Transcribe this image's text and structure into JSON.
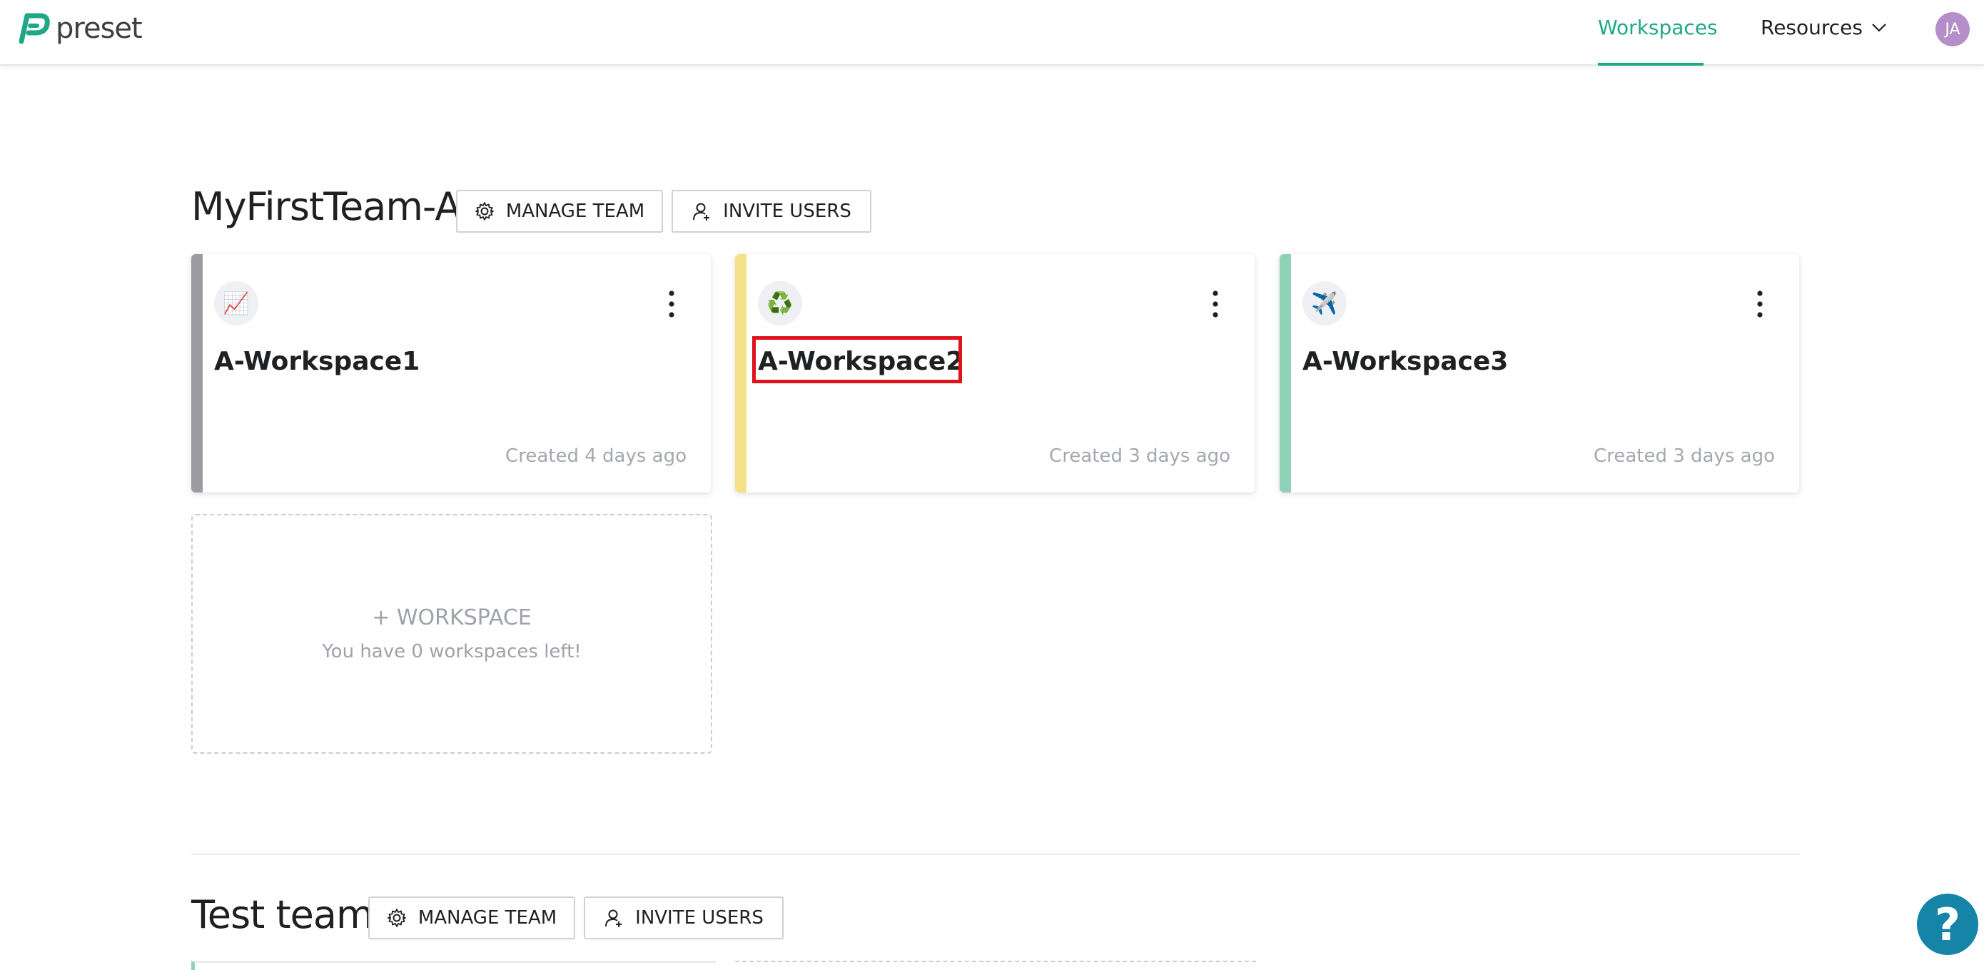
{
  "brand": {
    "name": "preset",
    "color": "#1fa887"
  },
  "nav": {
    "workspaces_label": "Workspaces",
    "resources_label": "Resources",
    "avatar_initials": "JA"
  },
  "teams": [
    {
      "name": "MyFirstTeam-A",
      "manage_label": "MANAGE TEAM",
      "invite_label": "INVITE USERS",
      "workspaces": [
        {
          "emoji": "📈",
          "title": "A-Workspace1",
          "created": "Created 4 days ago",
          "accent": "#9a9ca1"
        },
        {
          "emoji": "♻️",
          "title": "A-Workspace2",
          "created": "Created 3 days ago",
          "accent": "#f5e08a"
        },
        {
          "emoji": "✈️",
          "title": "A-Workspace3",
          "created": "Created 3 days ago",
          "accent": "#8fd1b6"
        }
      ],
      "add_workspace": {
        "label": "+ WORKSPACE",
        "sub": "You have 0 workspaces left!"
      }
    },
    {
      "name": "Test team",
      "manage_label": "MANAGE TEAM",
      "invite_label": "INVITE USERS"
    }
  ],
  "help": {
    "glyph": "?",
    "color": "#1584a6"
  }
}
